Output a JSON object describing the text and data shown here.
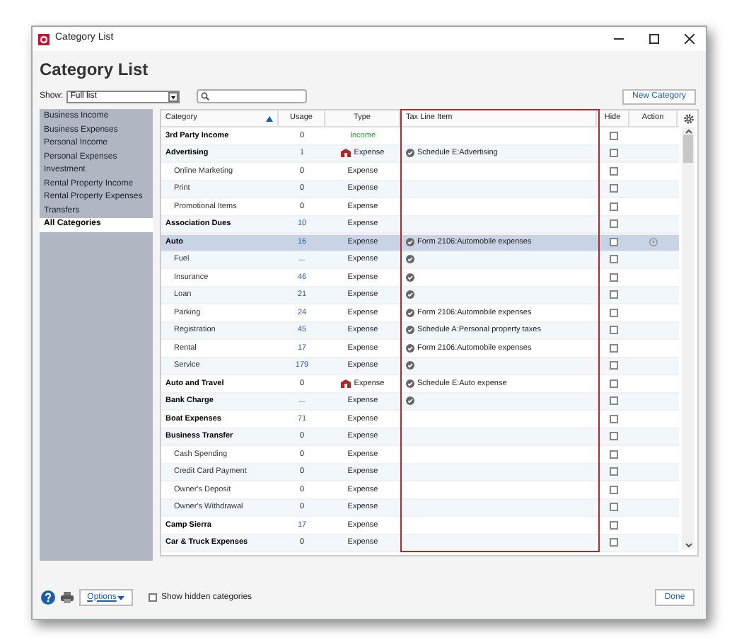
{
  "window": {
    "title": "Category List"
  },
  "heading": "Category List",
  "show": {
    "label": "Show:",
    "value": "Full list"
  },
  "new_button": "New Category",
  "sidebar": {
    "items": [
      {
        "label": "Business Income",
        "selected": false
      },
      {
        "label": "Business Expenses",
        "selected": false
      },
      {
        "label": "Personal Income",
        "selected": false
      },
      {
        "label": "Personal Expenses",
        "selected": false
      },
      {
        "label": "Investment",
        "selected": false
      },
      {
        "label": "Rental Property Income",
        "selected": false
      },
      {
        "label": "Rental Property Expenses",
        "selected": false
      },
      {
        "label": "Transfers",
        "selected": false
      },
      {
        "label": "All Categories",
        "selected": true
      }
    ]
  },
  "table": {
    "columns": [
      "Category",
      "Usage",
      "Type",
      "Tax Line Item",
      "Hide",
      "Action"
    ],
    "rows": [
      {
        "category": "3rd Party Income",
        "usage": "0",
        "linked": false,
        "type": "Income",
        "income": true,
        "business": false,
        "tax_marked": false,
        "hide": false,
        "selected": false
      },
      {
        "category": "Advertising",
        "usage": "1",
        "linked": true,
        "type": "Expense",
        "income": false,
        "business": true,
        "tax_marked": true,
        "tax": "Schedule E:Advertising",
        "hide": false,
        "selected": false,
        "children": [
          {
            "category": "Online Marketing",
            "usage": "0",
            "linked": false,
            "type": "Expense",
            "income": false,
            "business": false,
            "tax_marked": false,
            "hide": false,
            "selected": false
          },
          {
            "category": "Print",
            "usage": "0",
            "linked": false,
            "type": "Expense",
            "income": false,
            "business": false,
            "tax_marked": false,
            "hide": false,
            "selected": false
          },
          {
            "category": "Promotional Items",
            "usage": "0",
            "linked": false,
            "type": "Expense",
            "income": false,
            "business": false,
            "tax_marked": false,
            "hide": false,
            "selected": false
          }
        ]
      },
      {
        "category": "Association Dues",
        "usage": "10",
        "linked": true,
        "type": "Expense",
        "income": false,
        "business": false,
        "tax_marked": false,
        "hide": false,
        "selected": false
      },
      {
        "category": "Auto",
        "usage": "16",
        "linked": true,
        "type": "Expense",
        "income": false,
        "business": false,
        "tax_marked": true,
        "tax": "Form 2106:Automobile expenses",
        "hide": false,
        "selected": true,
        "children": [
          {
            "category": "Fuel",
            "usage": "...",
            "linked": true,
            "type": "Expense",
            "income": false,
            "business": false,
            "tax_marked": true,
            "hide": false,
            "selected": false
          },
          {
            "category": "Insurance",
            "usage": "46",
            "linked": true,
            "type": "Expense",
            "income": false,
            "business": false,
            "tax_marked": true,
            "hide": false,
            "selected": false
          },
          {
            "category": "Loan",
            "usage": "21",
            "linked": true,
            "type": "Expense",
            "income": false,
            "business": false,
            "tax_marked": true,
            "hide": false,
            "selected": false
          },
          {
            "category": "Parking",
            "usage": "24",
            "linked": true,
            "type": "Expense",
            "income": false,
            "business": false,
            "tax_marked": true,
            "tax": "Form 2106:Automobile expenses",
            "hide": false,
            "selected": false
          },
          {
            "category": "Registration",
            "usage": "45",
            "linked": true,
            "type": "Expense",
            "income": false,
            "business": false,
            "tax_marked": true,
            "tax": "Schedule A:Personal property taxes",
            "hide": false,
            "selected": false
          },
          {
            "category": "Rental",
            "usage": "17",
            "linked": true,
            "type": "Expense",
            "income": false,
            "business": false,
            "tax_marked": true,
            "tax": "Form 2106:Automobile expenses",
            "hide": false,
            "selected": false
          },
          {
            "category": "Service",
            "usage": "179",
            "linked": true,
            "type": "Expense",
            "income": false,
            "business": false,
            "tax_marked": true,
            "hide": false,
            "selected": false
          }
        ]
      },
      {
        "category": "Auto and Travel",
        "usage": "0",
        "linked": false,
        "type": "Expense",
        "income": false,
        "business": true,
        "tax_marked": true,
        "tax": "Schedule E:Auto expense",
        "hide": false,
        "selected": false
      },
      {
        "category": "Bank Charge",
        "usage": "...",
        "linked": true,
        "type": "Expense",
        "income": false,
        "business": false,
        "tax_marked": true,
        "hide": false,
        "selected": false
      },
      {
        "category": "Boat Expenses",
        "usage": "71",
        "linked": true,
        "type": "Expense",
        "income": false,
        "business": false,
        "tax_marked": false,
        "hide": false,
        "selected": false
      },
      {
        "category": "Business Transfer",
        "usage": "0",
        "linked": false,
        "type": "Expense",
        "income": false,
        "business": false,
        "tax_marked": false,
        "hide": false,
        "selected": false,
        "children": [
          {
            "category": "Cash Spending",
            "usage": "0",
            "linked": false,
            "type": "Expense",
            "income": false,
            "business": false,
            "tax_marked": false,
            "hide": false,
            "selected": false
          },
          {
            "category": "Credit Card Payment",
            "usage": "0",
            "linked": false,
            "type": "Expense",
            "income": false,
            "business": false,
            "tax_marked": false,
            "hide": false,
            "selected": false
          },
          {
            "category": "Owner's Deposit",
            "usage": "0",
            "linked": false,
            "type": "Expense",
            "income": false,
            "business": false,
            "tax_marked": false,
            "hide": false,
            "selected": false
          },
          {
            "category": "Owner's Withdrawal",
            "usage": "0",
            "linked": false,
            "type": "Expense",
            "income": false,
            "business": false,
            "tax_marked": false,
            "hide": false,
            "selected": false
          }
        ]
      },
      {
        "category": "Camp Sierra",
        "usage": "17",
        "linked": true,
        "type": "Expense",
        "income": false,
        "business": false,
        "tax_marked": false,
        "hide": false,
        "selected": false
      },
      {
        "category": "Car & Truck Expenses",
        "usage": "0",
        "linked": false,
        "type": "Expense",
        "income": false,
        "business": false,
        "tax_marked": false,
        "hide": false,
        "selected": false
      }
    ]
  },
  "footer": {
    "options": "Options",
    "show_hidden": {
      "label": "Show hidden categories",
      "checked": false
    },
    "done": "Done"
  }
}
